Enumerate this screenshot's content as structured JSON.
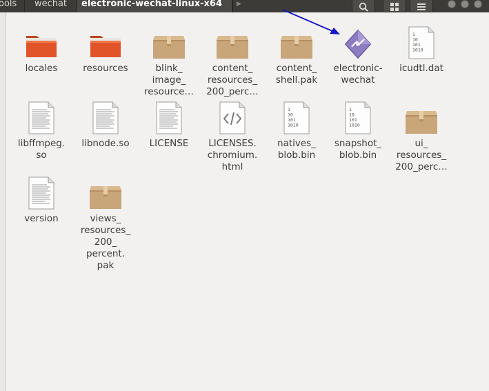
{
  "header": {
    "breadcrumbs": [
      {
        "label": "ools"
      },
      {
        "label": "wechat"
      },
      {
        "label": "electronic-wechat-linux-x64"
      }
    ],
    "icons": [
      "search-icon",
      "view-options-icon",
      "menu-icon"
    ]
  },
  "files": [
    {
      "name": "locales",
      "icon": "folder-icon"
    },
    {
      "name": "resources",
      "icon": "folder-icon"
    },
    {
      "name": "blink_\nimage_\nresource…",
      "icon": "package-icon"
    },
    {
      "name": "content_\nresources_\n200_perc…",
      "icon": "package-icon"
    },
    {
      "name": "content_\nshell.pak",
      "icon": "package-icon"
    },
    {
      "name": "electronic-\nwechat",
      "icon": "executable-icon"
    },
    {
      "name": "icudtl.dat",
      "icon": "binary-file-icon"
    },
    {
      "name": "libffmpeg.\nso",
      "icon": "text-file-icon"
    },
    {
      "name": "libnode.so",
      "icon": "text-file-icon"
    },
    {
      "name": "LICENSE",
      "icon": "text-file-icon"
    },
    {
      "name": "LICENSES.\nchromium.\nhtml",
      "icon": "html-file-icon"
    },
    {
      "name": "natives_\nblob.bin",
      "icon": "binary-file-icon"
    },
    {
      "name": "snapshot_\nblob.bin",
      "icon": "binary-file-icon"
    },
    {
      "name": "ui_\nresources_\n200_perc…",
      "icon": "package-icon"
    },
    {
      "name": "version",
      "icon": "text-file-icon"
    },
    {
      "name": "views_\nresources_\n200_\npercent.\npak",
      "icon": "package-icon"
    }
  ],
  "binary_glyph_lines": [
    "1",
    "10",
    "101",
    "1010"
  ],
  "colors": {
    "header_bg": "#3c3b37",
    "folder": "#e1542a",
    "package": "#c9a57a",
    "executable": "#8e7cc3",
    "annotation_arrow": "#1616c8"
  }
}
